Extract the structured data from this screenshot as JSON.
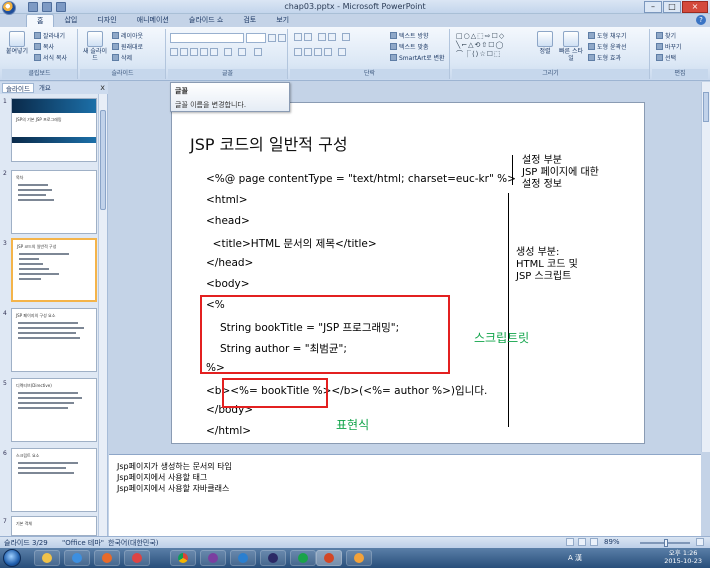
{
  "window": {
    "title": "chap03.pptx - Microsoft PowerPoint"
  },
  "ribbon": {
    "tabs": [
      "홈",
      "삽입",
      "디자인",
      "애니메이션",
      "슬라이드 쇼",
      "검토",
      "보기"
    ],
    "groups": {
      "clipboard": {
        "label": "클립보드",
        "paste": "붙여넣기",
        "cut": "잘라내기",
        "copy": "복사",
        "format_painter": "서식 복사"
      },
      "slides": {
        "label": "슬라이드",
        "new_slide": "새 슬라이드",
        "layout": "레이아웃",
        "reset": "원래대로",
        "delete": "삭제"
      },
      "font": {
        "label": "글꼴"
      },
      "paragraph": {
        "label": "단락",
        "text_direction": "텍스트 방향",
        "align_text": "텍스트 맞춤",
        "smartart": "SmartArt로 변환"
      },
      "drawing": {
        "label": "그리기",
        "arrange": "정렬",
        "quick_styles": "빠른 스타일",
        "shape_fill": "도형 채우기",
        "shape_outline": "도형 윤곽선",
        "shape_effects": "도형 효과"
      },
      "editing": {
        "label": "편집",
        "find": "찾기",
        "replace": "바꾸기",
        "select": "선택"
      }
    }
  },
  "tooltip": {
    "title": "글꼴",
    "description": "글꼴 이름을 변경합니다."
  },
  "left_panel": {
    "tabs": [
      "슬라이드",
      "개요"
    ],
    "close": "x",
    "thumbs": [
      {
        "num": "1",
        "title": "JSP의 기본 JSP 프로그래밍"
      },
      {
        "num": "2",
        "title": "목차"
      },
      {
        "num": "3",
        "title": "JSP 코드의 일반적 구성"
      },
      {
        "num": "4",
        "title": "JSP 페이지의 구성 요소"
      },
      {
        "num": "5",
        "title": "디렉티브(Directive)"
      },
      {
        "num": "6",
        "title": "스크립트 요소"
      },
      {
        "num": "7",
        "title": "기본 객체"
      }
    ]
  },
  "slide": {
    "title": "JSP 코드의 일반적 구성",
    "code_lines": [
      "<%@ page contentType = \"text/html; charset=euc-kr\" %>",
      "<html>",
      "<head>",
      "  <title>HTML 문서의 제목</title>",
      "</head>",
      "<body>",
      "<%",
      "String bookTitle = \"JSP 프로그래밍\";",
      "String author = \"최범균\";",
      "%>",
      "<b><%= bookTitle %></b>(<%= author %>)입니다.",
      "</body>",
      "</html>"
    ],
    "annot_settings": [
      "설정 부분",
      "JSP 페이지에 대한",
      "설정 정보"
    ],
    "annot_generate": [
      "생성 부분:",
      "HTML 코드 및",
      "JSP 스크립트"
    ],
    "label_scriptlet": "스크립트릿",
    "label_expression": "표현식"
  },
  "notes": [
    "Jsp페이지가 생성하는 문서의 타입",
    "Jsp페이지에서 사용할 태그",
    "Jsp페이지에서 사용할 자바클래스"
  ],
  "statusbar": {
    "slide_info": "슬라이드 3/29",
    "theme": "\"Office 테마\"",
    "language": "한국어(대한민국)",
    "zoom": "89%"
  },
  "taskbar": {
    "tray": "A 漢",
    "time": "오후 1:26",
    "date": "2015-10-23"
  }
}
